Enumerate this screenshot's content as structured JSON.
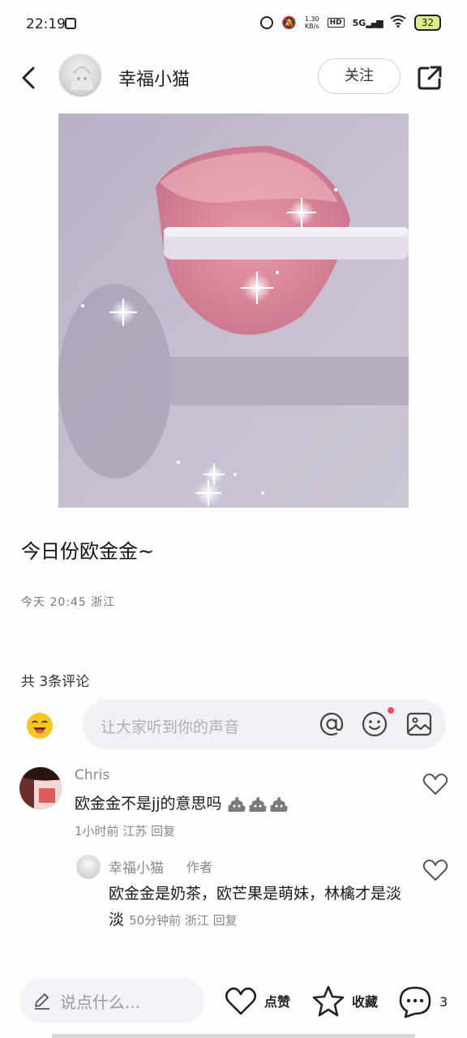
{
  "status_bar": {
    "time": "22:19",
    "net_speed_value": "1.30",
    "net_speed_unit": "KB/s",
    "hd": "HD",
    "signal": "5G",
    "battery": "32"
  },
  "header": {
    "author_name": "幸福小猫",
    "follow_label": "关注"
  },
  "post": {
    "title": "今日份欧金金~",
    "meta": "今天 20:45 浙江"
  },
  "comments_section": {
    "count_label": "共 3条评论",
    "input_placeholder": "让大家听到你的声音"
  },
  "comments": [
    {
      "name": "Chris",
      "text": "欧金金不是jj的意思吗",
      "meta": "1小时前 江苏 回复",
      "reply": {
        "name": "幸福小猫",
        "tag": "作者",
        "text": "欧金金是奶茶，欧芒果是萌妹，林檎才是淡淡",
        "meta": "50分钟前 浙江 回复"
      }
    }
  ],
  "bottom_bar": {
    "say_placeholder": "说点什么...",
    "like_label": "点赞",
    "collect_label": "收藏",
    "comment_count": "3"
  },
  "colors": {
    "notification_dot": "#ff4a5c",
    "battery_fill": "#d8f08a"
  }
}
